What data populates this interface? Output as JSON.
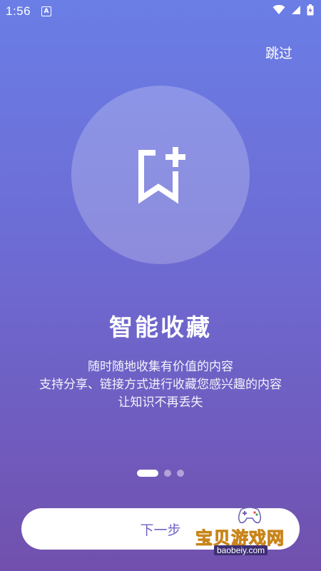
{
  "status_bar": {
    "time": "1:56",
    "a_badge": "A"
  },
  "header": {
    "skip_label": "跳过"
  },
  "hero": {
    "icon": "bookmark-add-icon"
  },
  "onboarding": {
    "title": "智能收藏",
    "lines": [
      "随时随地收集有价值的内容",
      "支持分享、链接方式进行收藏您感兴趣的内容",
      "让知识不再丢失"
    ],
    "page_index": 1,
    "page_count": 3
  },
  "footer": {
    "next_label": "下一步"
  },
  "watermark": {
    "text": "宝贝游戏网",
    "url": "baobeiy.com"
  },
  "colors": {
    "bg_top": "#6a7ee6",
    "bg_bottom": "#7150ad",
    "button_text": "#6f63c9"
  }
}
